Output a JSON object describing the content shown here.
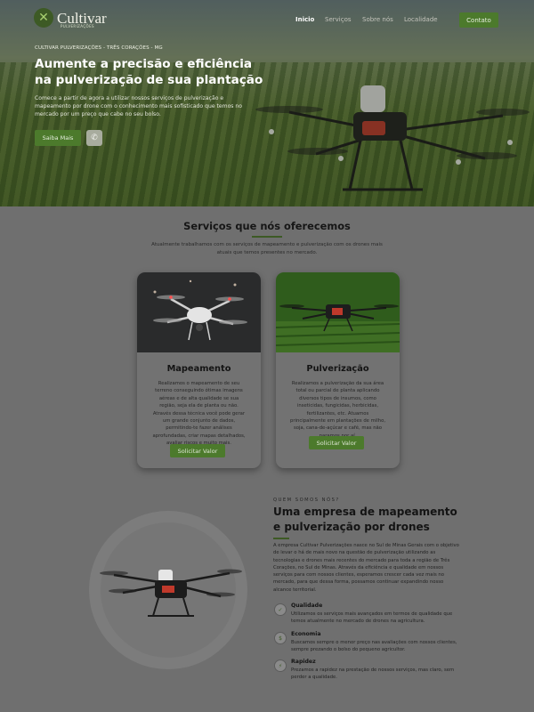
{
  "brand": {
    "name": "Cultivar",
    "tagline": "PULVERIZAÇÕES"
  },
  "nav": {
    "items": [
      {
        "label": "Inicio",
        "active": true
      },
      {
        "label": "Serviços",
        "active": false
      },
      {
        "label": "Sobre nós",
        "active": false
      },
      {
        "label": "Localidade",
        "active": false
      }
    ],
    "cta": "Contato"
  },
  "hero": {
    "tag": "CULTIVAR PULVERIZAÇÕES - TRÊS CORAÇÕES - MG",
    "title": "Aumente a precisão e eficiência na pulverização de sua plantação",
    "description": "Comece a partir de agora a utilizar nossos serviços de pulverização e mapeamento por drone com o conhecimento mais sofisticado que temos no mercado por um preço que cabe no seu bolso.",
    "button": "Saiba Mais",
    "whatsapp_icon": "whatsapp-icon"
  },
  "services": {
    "title": "Serviços que nós oferecemos",
    "description": "Atualmente trabalhamos com os serviços de mapeamento e pulverização com os drones mais atuais que temos presentes no mercado.",
    "cards": [
      {
        "title": "Mapeamento",
        "text": "Realizamos o mapeamento de seu terreno conseguindo ótimas imagens aéreas e de alta qualidade se sua região, seja ela de planta ou não. Através dessa técnica você pode gerar um grande conjunto de dados, permitindo-te fazer análises aprofundadas, criar mapas detalhados, avaliar riscos e muito mais.",
        "button": "Solicitar Valor"
      },
      {
        "title": "Pulverização",
        "text": "Realizamos a pulverização da sua área total ou parcial de planta aplicando diversos tipos de insumos, como inseticidas, fungicidas, herbicidas, fertilizantes, etc. Atuamos principalmente em plantações de milho, soja, cana-de-açúcar e café, mas não paramos por aí.",
        "button": "Solicitar Valor"
      }
    ]
  },
  "about": {
    "kicker": "QUEM SOMOS NÓS?",
    "title": "Uma empresa de mapeamento e pulverização por drones",
    "text": "A empresa Cultivar Pulverizações nasce no Sul de Minas Gerais com o objetivo de levar o há de mais novo na questão de pulverização utilizando as tecnologias e drones mais recentes do mercado para toda a região de Três Corações, no Sul de Minas. Através da eficiência e qualidade em nossos serviços para com nossos clientes, esperamos crescer cada vez mais no mercado, para que dessa forma, possamos continuar expandindo nosso alcance territorial.",
    "features": [
      {
        "icon": "quality-icon",
        "title": "Qualidade",
        "text": "Utilizamos os serviços mais avançados em termos de qualidade que temos atualmente no mercado de drones na agricultura."
      },
      {
        "icon": "economy-icon",
        "title": "Economia",
        "text": "Buscamos sempre o menor preço nas avaliações com nossos clientes, sempre prezando o bolso do pequeno agricultor."
      },
      {
        "icon": "speed-icon",
        "title": "Rapidez",
        "text": "Prezamos a rapidez na prestação de nossos serviços, mas claro, sem perder a qualidade."
      }
    ]
  },
  "colors": {
    "accent": "#4c7a2c",
    "dark_green": "#3d5a25",
    "overlay": "#6f6f6f"
  }
}
